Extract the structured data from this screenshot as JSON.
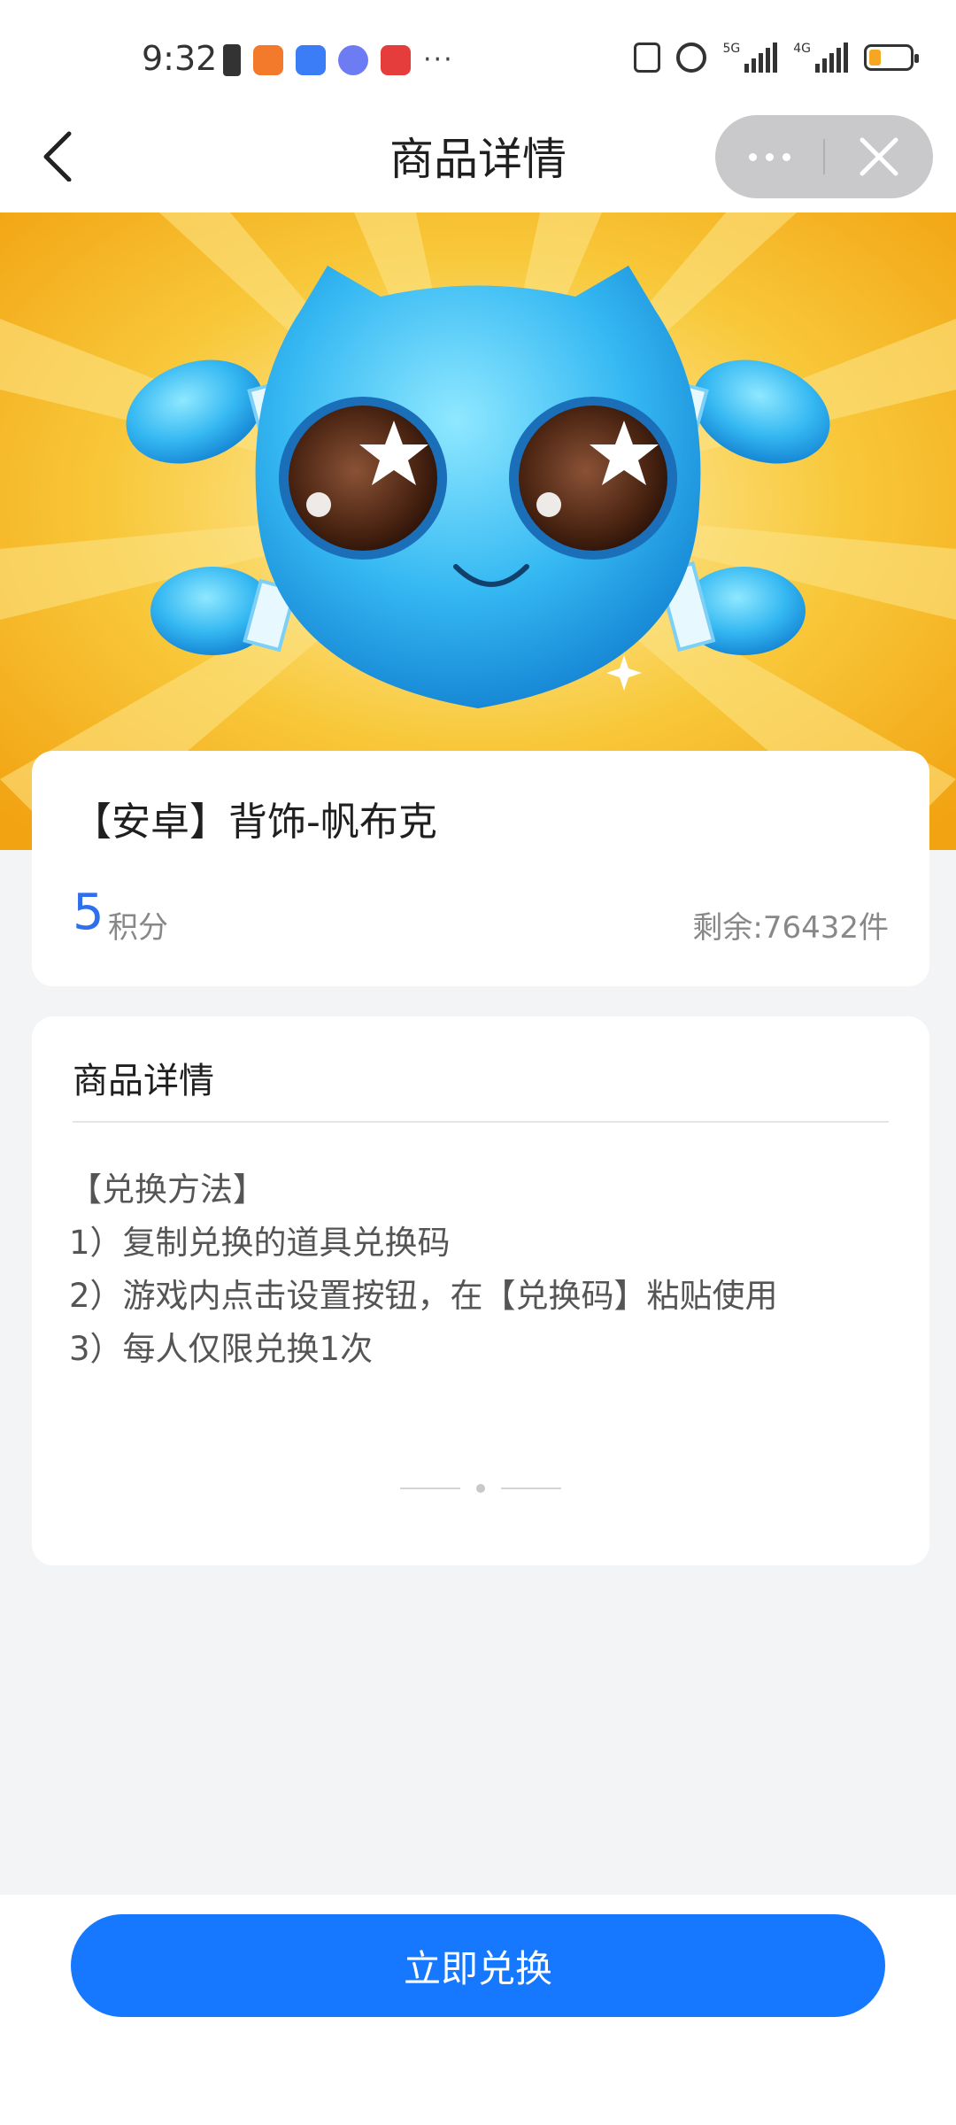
{
  "status_bar": {
    "time": "9:32",
    "more": "···",
    "net_5g": "5G",
    "net_4g": "4G",
    "battery_level_fraction": 0.3,
    "battery_color": "#f5a623"
  },
  "header": {
    "title": "商品详情",
    "back_icon": "chevron-left-icon",
    "more_icon": "more-dots-icon",
    "close_icon": "close-icon"
  },
  "banner": {
    "image": "blue-cat-pet-on-sunburst",
    "bg_color": "#f6b41f"
  },
  "product": {
    "title": "【安卓】背饰-帆布克",
    "price": "5",
    "price_unit": "积分",
    "stock": "剩余:76432件",
    "accent_color": "#2f6fed"
  },
  "detail": {
    "heading": "商品详情",
    "lines": [
      "【兑换方法】",
      "1）复制兑换的道具兑换码",
      "2）游戏内点击设置按钮，在【兑换码】粘贴使用",
      "3）每人仅限兑换1次"
    ]
  },
  "action": {
    "redeem_label": "立即兑换",
    "button_color": "#1677ff"
  }
}
